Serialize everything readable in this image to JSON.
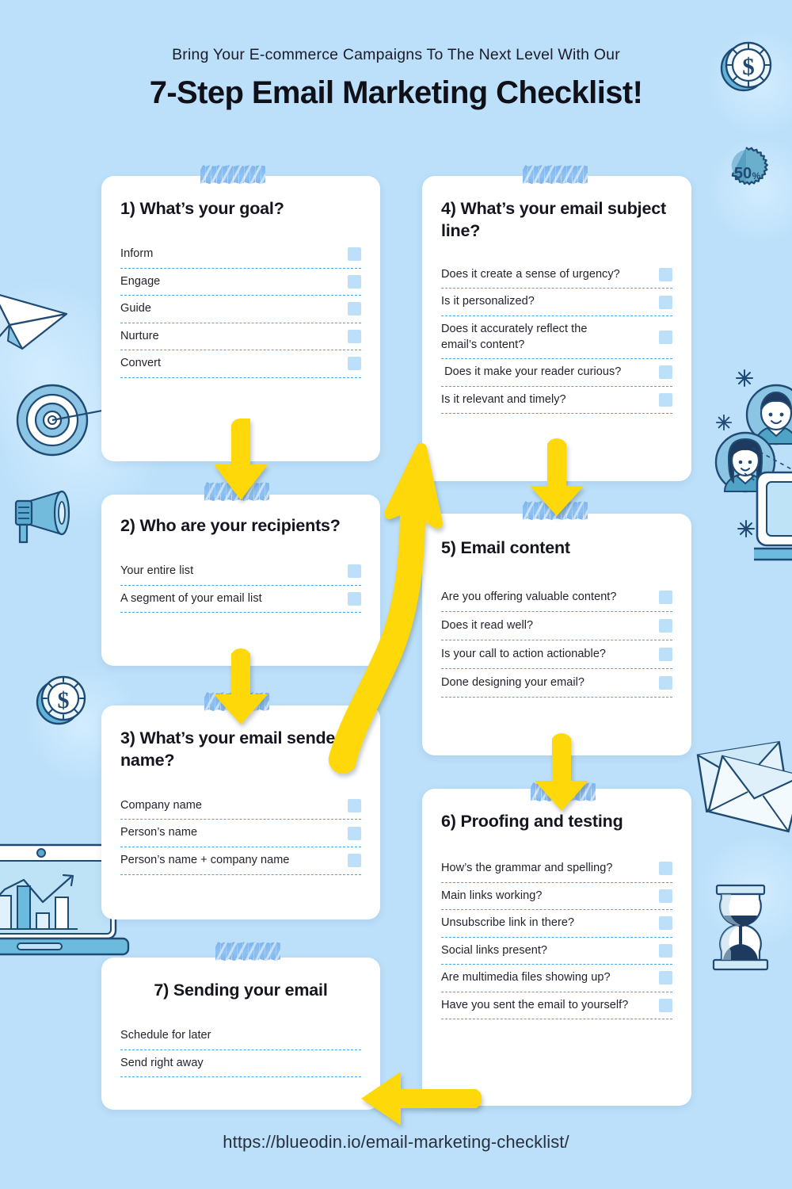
{
  "header": {
    "subtitle": "Bring Your E-commerce Campaigns To The Next Level With Our",
    "title": "7-Step Email Marketing Checklist!"
  },
  "footer": {
    "url": "https://blueodin.io/email-marketing-checklist/"
  },
  "colors": {
    "background": "#bce0fa",
    "card": "#ffffff",
    "checkbox": "#bce0fa",
    "dashed_line": "#4fa3ea",
    "arrow_yellow": "#ffd80a",
    "tape_blue": "#79b2ed",
    "text_dark": "#15151f"
  },
  "cards": [
    {
      "id": 1,
      "title": "1) What’s your goal?",
      "items": [
        {
          "label": "Inform",
          "checkbox": true
        },
        {
          "label": "Engage",
          "checkbox": true
        },
        {
          "label": "Guide",
          "checkbox": true
        },
        {
          "label": "Nurture",
          "checkbox": true
        },
        {
          "label": "Convert",
          "checkbox": true
        }
      ]
    },
    {
      "id": 2,
      "title": "2) Who are your recipients?",
      "items": [
        {
          "label": "Your entire list",
          "checkbox": true
        },
        {
          "label": "A segment of your email list",
          "checkbox": true
        }
      ]
    },
    {
      "id": 3,
      "title": "3) What’s your email sender name?",
      "items": [
        {
          "label": "Company name",
          "checkbox": true
        },
        {
          "label": "Person’s name",
          "checkbox": true
        },
        {
          "label": "Person’s name + company name",
          "checkbox": true
        }
      ]
    },
    {
      "id": 4,
      "title": "4) What’s your email subject line?",
      "items": [
        {
          "label": "Does it create a sense of urgency?",
          "checkbox": true
        },
        {
          "label": "Is it personalized?",
          "checkbox": true
        },
        {
          "label": "Does it accurately reflect the\nemail’s content?",
          "checkbox": true
        },
        {
          "label": " Does it make your reader curious?",
          "checkbox": true
        },
        {
          "label": "Is it relevant and timely?",
          "checkbox": true
        }
      ]
    },
    {
      "id": 5,
      "title": "5) Email content",
      "items": [
        {
          "label": "Are you offering valuable content?",
          "checkbox": true
        },
        {
          "label": "Does it read well?",
          "checkbox": true
        },
        {
          "label": "Is your call to action actionable?",
          "checkbox": true
        },
        {
          "label": "Done designing your email?",
          "checkbox": true
        }
      ]
    },
    {
      "id": 6,
      "title": "6) Proofing and testing",
      "items": [
        {
          "label": "How’s the grammar and spelling?",
          "checkbox": true
        },
        {
          "label": "Main links working?",
          "checkbox": true
        },
        {
          "label": "Unsubscribe link in there?",
          "checkbox": true
        },
        {
          "label": "Social links present?",
          "checkbox": true
        },
        {
          "label": "Are multimedia files showing up?",
          "checkbox": true
        },
        {
          "label": "Have you sent the email to yourself?",
          "checkbox": true
        }
      ]
    },
    {
      "id": 7,
      "title": "7) Sending your email",
      "items": [
        {
          "label": "Schedule for later",
          "checkbox": false
        },
        {
          "label": "Send right away",
          "checkbox": false
        }
      ]
    }
  ],
  "decorations": [
    {
      "name": "dollar-coin-icon",
      "position": "top-right"
    },
    {
      "name": "fifty-percent-badge-icon",
      "label": "50%",
      "position": "top-right"
    },
    {
      "name": "paper-plane-icon",
      "position": "left"
    },
    {
      "name": "target-dartboard-icon",
      "position": "left"
    },
    {
      "name": "megaphone-icon",
      "position": "left"
    },
    {
      "name": "dollar-coin-icon",
      "position": "left-lower"
    },
    {
      "name": "laptop-bar-chart-icon",
      "position": "bottom-left"
    },
    {
      "name": "avatar-man-icon",
      "position": "right"
    },
    {
      "name": "avatar-woman-icon",
      "position": "right"
    },
    {
      "name": "sparkle-icon",
      "position": "right"
    },
    {
      "name": "monitor-icon",
      "position": "right"
    },
    {
      "name": "envelopes-icon",
      "position": "right-lower"
    },
    {
      "name": "hourglass-icon",
      "position": "right-lower"
    }
  ],
  "arrows": [
    {
      "name": "arrow-card1-to-card2",
      "direction": "down"
    },
    {
      "name": "arrow-card2-to-card3",
      "direction": "down"
    },
    {
      "name": "arrow-card3-to-card4",
      "direction": "curved-up-right"
    },
    {
      "name": "arrow-card4-to-card5",
      "direction": "down"
    },
    {
      "name": "arrow-card5-to-card6",
      "direction": "down"
    },
    {
      "name": "arrow-card6-to-card7",
      "direction": "left"
    }
  ]
}
